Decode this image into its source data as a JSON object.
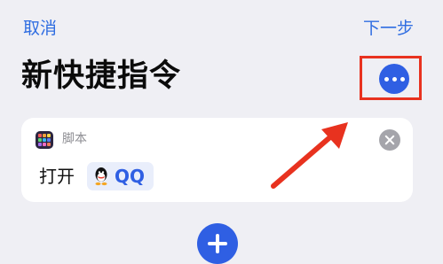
{
  "nav": {
    "cancel_label": "取消",
    "next_label": "下一步"
  },
  "page": {
    "title": "新快捷指令"
  },
  "action_card": {
    "category_label": "脚本",
    "category_icon": "scripting-app-icon",
    "action_verb": "打开",
    "app_token": {
      "icon": "qq-penguin-icon",
      "label": "QQ"
    }
  },
  "icons": {
    "more": "more-horizontal-icon",
    "clear": "clear-circle-icon",
    "add": "plus-icon"
  },
  "annotation": {
    "highlight_color": "#e8321f",
    "target": "more-options-button"
  },
  "colors": {
    "accent": "#2f5fe3",
    "link": "#2f6de1",
    "background": "#efeff4",
    "card": "#ffffff"
  }
}
